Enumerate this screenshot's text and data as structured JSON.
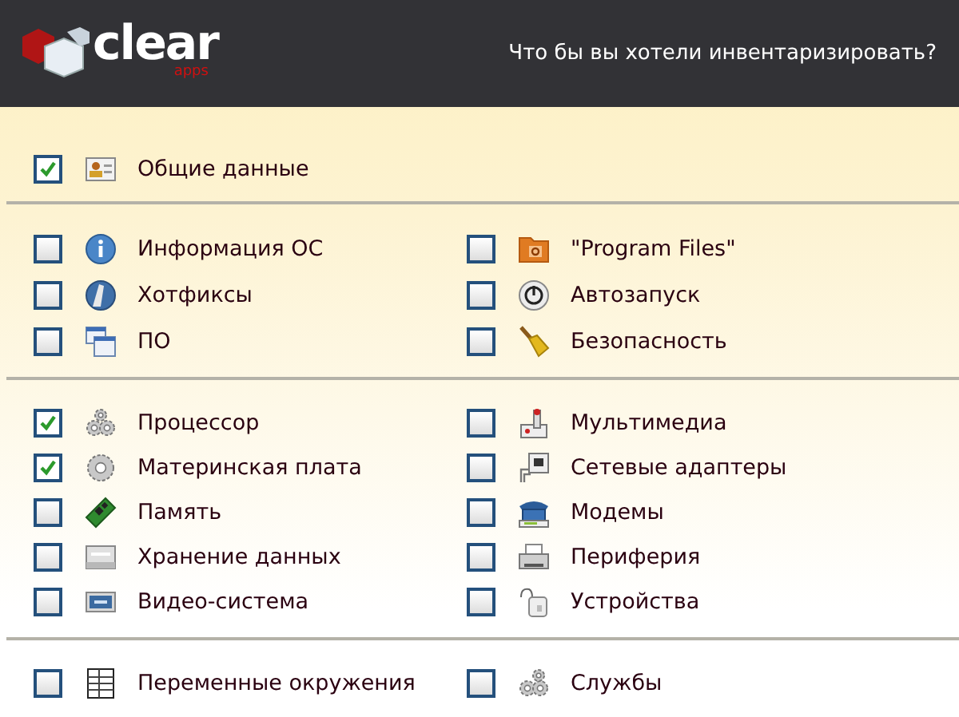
{
  "header": {
    "logo": {
      "name": "clear",
      "sub": "apps"
    },
    "title": "Что бы вы хотели инвентаризировать?"
  },
  "sections": [
    {
      "columns": [
        [
          {
            "label": "Общие данные",
            "checked": true
          }
        ]
      ]
    },
    {
      "columns": [
        [
          {
            "label": "Информация ОС",
            "checked": false
          },
          {
            "label": "Хотфиксы",
            "checked": false
          },
          {
            "label": "ПО",
            "checked": false
          }
        ],
        [
          {
            "label": "\"Program Files\"",
            "checked": false
          },
          {
            "label": "Автозапуск",
            "checked": false
          },
          {
            "label": "Безопасность",
            "checked": false
          }
        ]
      ]
    },
    {
      "columns": [
        [
          {
            "label": "Процессор",
            "checked": true
          },
          {
            "label": "Материнская плата",
            "checked": true
          },
          {
            "label": "Память",
            "checked": false
          },
          {
            "label": "Хранение данных",
            "checked": false
          },
          {
            "label": "Видео-система",
            "checked": false
          }
        ],
        [
          {
            "label": "Мультимедиа",
            "checked": false
          },
          {
            "label": "Сетевые адаптеры",
            "checked": false
          },
          {
            "label": "Модемы",
            "checked": false
          },
          {
            "label": "Периферия",
            "checked": false
          },
          {
            "label": "Устройства",
            "checked": false
          }
        ]
      ]
    },
    {
      "columns": [
        [
          {
            "label": "Переменные окружения",
            "checked": false
          }
        ],
        [
          {
            "label": "Службы",
            "checked": false
          }
        ]
      ]
    }
  ]
}
